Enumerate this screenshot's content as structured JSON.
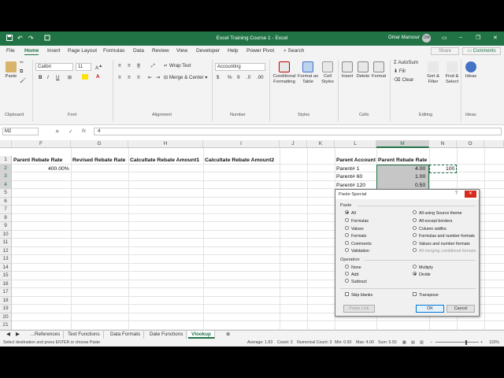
{
  "titlebar": {
    "title": "Excel Training Course 1  -  Excel",
    "user": "Omar Mansour",
    "avatar_initials": "OM",
    "undo_glyph": "↶",
    "redo_glyph": "↷",
    "minimize_glyph": "–",
    "restore_glyph": "❐",
    "close_glyph": "✕",
    "ribbon_options_glyph": "▭"
  },
  "menu": {
    "tabs": [
      "File",
      "Home",
      "Insert",
      "Page Layout",
      "Formulas",
      "Data",
      "Review",
      "View",
      "Developer",
      "Help",
      "Power Pivot"
    ],
    "active": "Home",
    "search": "Search",
    "share": "Share",
    "comments": "Comments"
  },
  "ribbon": {
    "clipboard": {
      "label": "Clipboard",
      "paste": "Paste"
    },
    "font": {
      "label": "Font",
      "name": "Calibri",
      "size": "11",
      "bold": "B",
      "italic": "I",
      "underline": "U"
    },
    "alignment": {
      "label": "Alignment",
      "wrap": "Wrap Text",
      "merge": "Merge & Center"
    },
    "number": {
      "label": "Number",
      "format": "Accounting",
      "currency": "$",
      "percent": "%",
      "comma": "9"
    },
    "styles": {
      "label": "Styles",
      "conditional": "Conditional Formatting",
      "format_table": "Format as Table",
      "cell_styles": "Cell Styles"
    },
    "cells": {
      "label": "Cells",
      "insert": "Insert",
      "delete": "Delete",
      "format": "Format"
    },
    "editing": {
      "label": "Editing",
      "autosum": "AutoSum",
      "fill": "Fill",
      "clear": "Clear",
      "sort": "Sort & Filter",
      "find": "Find & Select"
    },
    "ideas": {
      "label": "Ideas",
      "ideas": "Ideas"
    }
  },
  "formula_bar": {
    "name_box": "M2",
    "fx": "fx",
    "value": "4"
  },
  "columns": [
    "F",
    "G",
    "H",
    "I",
    "J",
    "K",
    "L",
    "M",
    "N",
    "O"
  ],
  "rows": [
    "1",
    "2",
    "3",
    "4",
    "5",
    "6",
    "7",
    "8",
    "9",
    "10",
    "11",
    "12",
    "13",
    "14",
    "15",
    "16",
    "17",
    "18",
    "19",
    "20",
    "21"
  ],
  "cells": {
    "F1": "Parent Rebate Rate",
    "G1": "Revised Rebate Rate",
    "H1": "Calcultate Rebate Amount1",
    "I1": "Calcultate Rebate Amount2",
    "F2": "400.00%",
    "L1": "Parent Account",
    "M1": "Parent Rebate Rate",
    "L2": "Parent# 1",
    "L3": "Parent# 60",
    "L4": "Parent# 120",
    "M2": "4.00",
    "M3": "1.00",
    "M4": "0.50",
    "N2": "100"
  },
  "sheets": {
    "tabs": [
      "References",
      "Text Functions",
      "Data Formats",
      "Date Functions",
      "Vlookup"
    ],
    "active": "Vlookup"
  },
  "status": {
    "message": "Select destination and press ENTER or choose Paste",
    "average": "Average: 1.83",
    "count": "Count: 3",
    "numerical_count": "Numerical Count: 3",
    "min": "Min: 0.50",
    "max": "Max: 4.00",
    "sum": "Sum: 5.50",
    "zoom": "115%"
  },
  "dialog": {
    "title": "Paste Special",
    "help": "?",
    "paste_label": "Paste",
    "paste_left": [
      "All",
      "Formulas",
      "Values",
      "Formats",
      "Comments",
      "Validation"
    ],
    "paste_right": [
      "All using Source theme",
      "All except borders",
      "Column widths",
      "Formulas and number formats",
      "Values and number formats",
      "All merging conditional formats"
    ],
    "operation_label": "Operation",
    "op_left": [
      "None",
      "Add",
      "Subtract"
    ],
    "op_right": [
      "Multiply",
      "Divide"
    ],
    "skip_blanks": "Skip blanks",
    "transpose": "Transpose",
    "paste_link": "Paste Link",
    "ok": "OK",
    "cancel": "Cancel"
  }
}
